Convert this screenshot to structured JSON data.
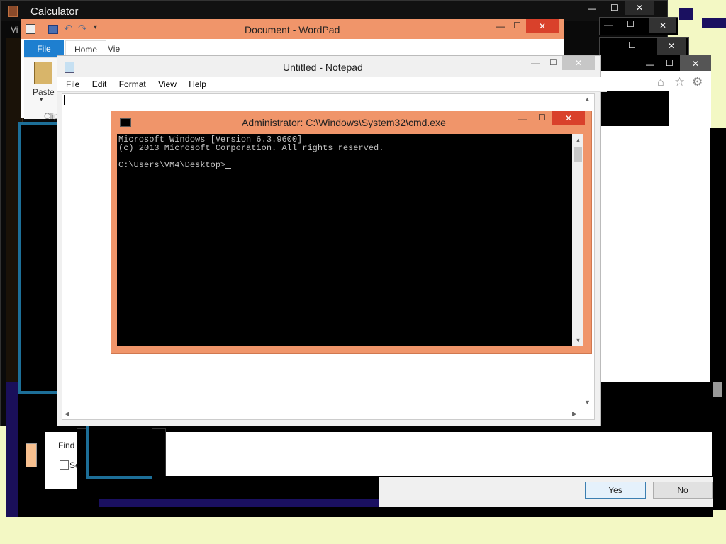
{
  "calculator": {
    "title": "Calculator",
    "menu_initial": "Vi"
  },
  "wordpad": {
    "title": "Document - WordPad",
    "tabs": {
      "file": "File",
      "home": "Home",
      "view": "Vie"
    },
    "paste_label": "Paste",
    "group_label": "Clip"
  },
  "notepad": {
    "title": "Untitled - Notepad",
    "menu": [
      "File",
      "Edit",
      "Format",
      "View",
      "Help"
    ]
  },
  "cmd": {
    "title": "Administrator: C:\\Windows\\System32\\cmd.exe",
    "lines": [
      "Microsoft Windows [Version 6.3.9600]",
      "(c) 2013 Microsoft Corporation. All rights reserved.",
      "",
      "C:\\Users\\VM4\\Desktop>"
    ]
  },
  "find_dialog": {
    "find_label": "Find wh",
    "search_label": "Sear"
  },
  "dialog_buttons": {
    "yes": "Yes",
    "no": "No"
  },
  "colors": {
    "desktop": "#f3f8c4",
    "titlebar_orange": "#f0956a",
    "close_red": "#d9412b",
    "accent_blue": "#1e7fd0",
    "teal_border": "#1d6f98"
  }
}
